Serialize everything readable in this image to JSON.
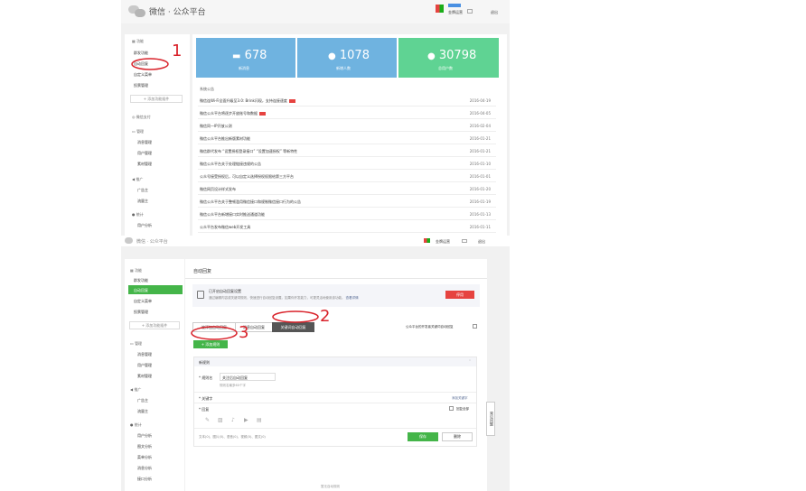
{
  "top": {
    "header": {
      "brand": "微信 · 公众平台",
      "golden_label": "金牌运营",
      "logout": "退出"
    },
    "sidebar": {
      "function_label": "功能",
      "items": [
        "群发功能",
        "自动回复",
        "自定义菜单",
        "投票管理"
      ],
      "add_plugin": "+ 添加功能插件",
      "pay_label": "微信支付",
      "manage_label": "管理",
      "manage_items": [
        "消息管理",
        "用户管理",
        "素材管理"
      ],
      "promo_label": "推广",
      "promo_items": [
        "广告主",
        "流量主"
      ],
      "stats_label": "统计",
      "stats_items": [
        "用户分析"
      ]
    },
    "stats": [
      {
        "value": "678",
        "label": "新消息",
        "icon": "chat-icon",
        "color": "#6fb3e0"
      },
      {
        "value": "1078",
        "label": "新增人数",
        "icon": "user-icon",
        "color": "#6fb3e0"
      },
      {
        "value": "30798",
        "label": "总用户数",
        "icon": "users-icon",
        "color": "#5fd393"
      }
    ],
    "notice_title": "系统公告",
    "notices": [
      {
        "title": "微信连Wi-Fi全面升级至3.0: Brink闪现，支持连接速度",
        "date": "2016-04-19",
        "new": true
      },
      {
        "title": "微信公众平台将逐步开放账号和数据",
        "date": "2016-04-05",
        "new": true
      },
      {
        "title": "微信同一IP开放公测",
        "date": "2016-02-04",
        "new": false
      },
      {
        "title": "微信公众平台推出新版素材功能",
        "date": "2016-01-21",
        "new": false
      },
      {
        "title": "微信群代发布 “设置授权登录接口” “设置加速授权” 等新特性",
        "date": "2016-01-21",
        "new": false
      },
      {
        "title": "微信公众平台关于处理链接违规的公告",
        "date": "2016-01-10",
        "new": false
      },
      {
        "title": "公众号接受授权后，可以自定义选择授权权限给第三方平台",
        "date": "2016-01-01",
        "new": false
      },
      {
        "title": "微信网页设计样式发布",
        "date": "2016-01-20",
        "new": false
      },
      {
        "title": "微信公众平台关于整顿滥用微信接口和规制微信接口行为的公告",
        "date": "2016-01-19",
        "new": false
      },
      {
        "title": "微信公众平台新增接口实时推送通道功能",
        "date": "2016-01-13",
        "new": false
      },
      {
        "title": "公众平台发布微信web开发工具",
        "date": "2016-01-11",
        "new": false
      }
    ]
  },
  "bottom": {
    "header": {
      "brand": "微信 · 公众平台",
      "golden_label": "金牌运营",
      "logout": "退出"
    },
    "sidebar": {
      "function_label": "功能",
      "items": [
        "群发功能",
        "自动回复",
        "自定义菜单",
        "投票管理"
      ],
      "add_plugin": "+ 添加功能插件",
      "manage_label": "管理",
      "manage_items": [
        "消息管理",
        "用户管理",
        "素材管理"
      ],
      "promo_label": "推广",
      "promo_items": [
        "广告主",
        "流量主"
      ],
      "stats_label": "统计",
      "stats_items": [
        "用户分析",
        "图文分析",
        "菜单分析",
        "消息分析",
        "接口分析"
      ]
    },
    "page_title": "自动回复",
    "enabled_title": "已开启自动回复设置",
    "enabled_desc": "通过编辑内容或关键词规则，快速进行自动回复设置。如果你开发能力，可更灵活地使用该功能。",
    "enabled_link": "查看详情",
    "disable_btn": "停用",
    "tabs": [
      "被添加自动回复",
      "消息自动回复",
      "关键词自动回复"
    ],
    "checkbox_label": "公众平台的开发者关键词自动回复",
    "add_rule": "+ 添加规则",
    "rule_header": "新规则",
    "rule_name_label": "规则名",
    "rule_name_value": "关注后自动回复",
    "rule_name_hint": "规则名最多60个字",
    "keyword_label": "关键字",
    "add_keyword": "添加关键字",
    "reply_label": "回复",
    "reply_all": "回复全部",
    "media_types": "文本(0)、图片(0)、语音(0)、视频(0)、图文(0)",
    "save_btn": "保存",
    "delete_btn": "删除",
    "empty_hint": "暂无自动规则",
    "float_help": "常见问题"
  },
  "annotations": [
    "1",
    "2",
    "3"
  ]
}
